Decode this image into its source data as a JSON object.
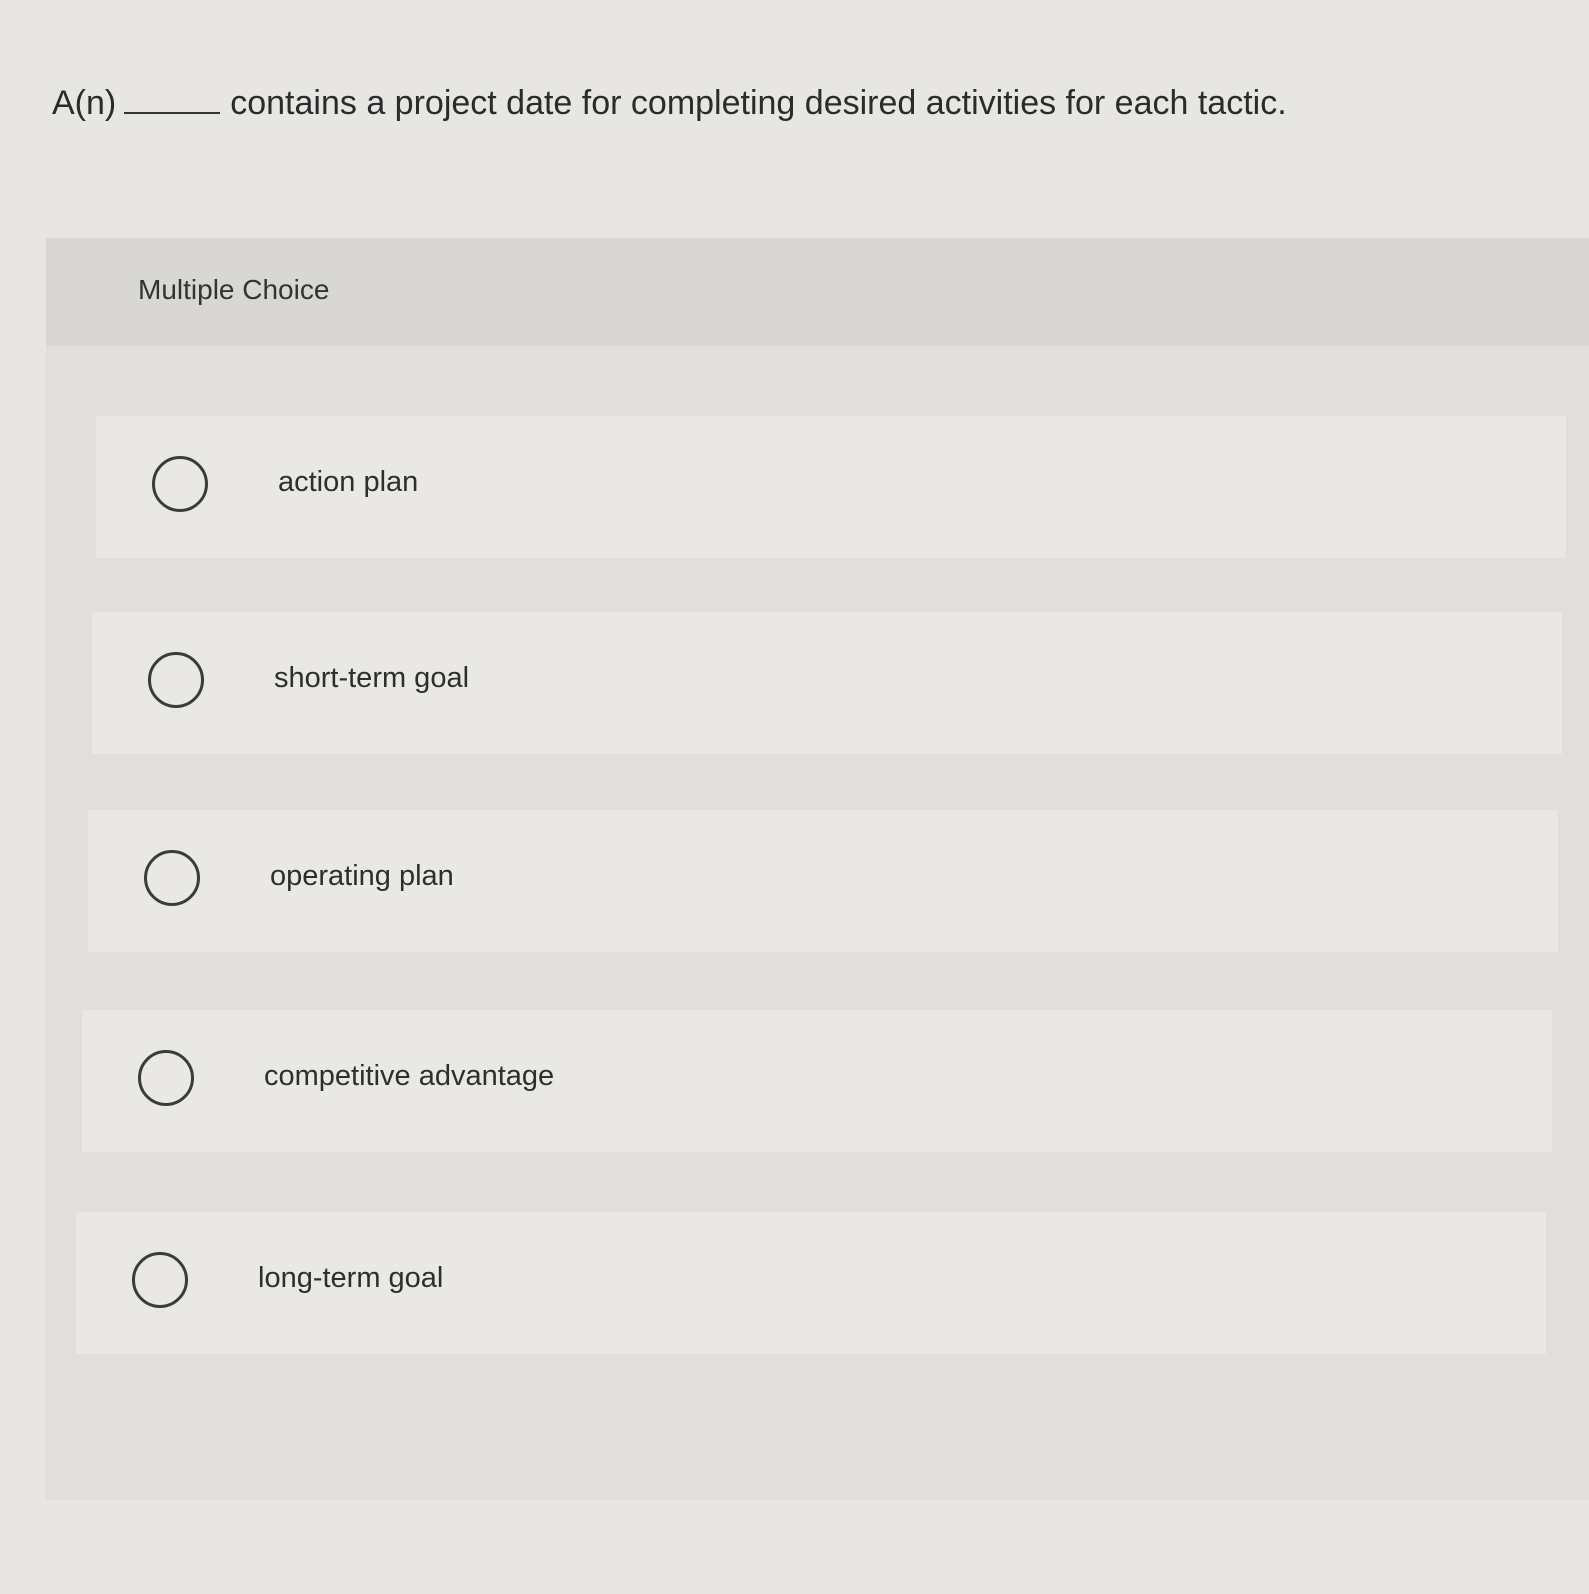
{
  "question": {
    "prefix": "A(n)",
    "suffix": "contains a project date for completing desired activities for each tactic."
  },
  "panel": {
    "label": "Multiple Choice"
  },
  "options": [
    {
      "label": "action plan"
    },
    {
      "label": "short-term goal"
    },
    {
      "label": "operating plan"
    },
    {
      "label": "competitive advantage"
    },
    {
      "label": "long-term goal"
    }
  ]
}
